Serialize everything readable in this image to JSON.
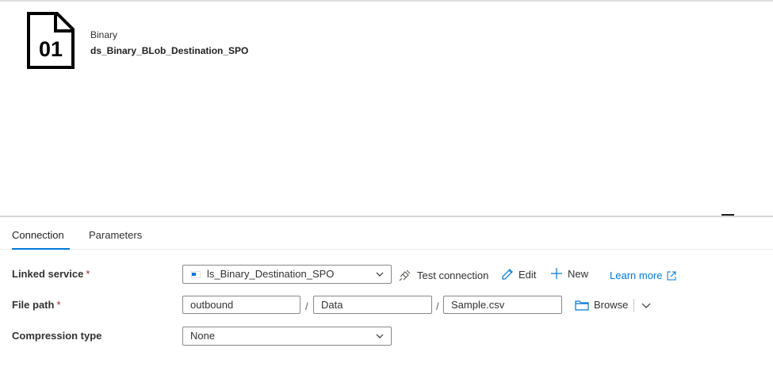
{
  "dataset": {
    "type_label": "Binary",
    "name": "ds_Binary_BLob_Destination_SPO",
    "icon": "binary-file-icon",
    "icon_text": "01"
  },
  "tabs": [
    {
      "label": "Connection",
      "active": true
    },
    {
      "label": "Parameters",
      "active": false
    }
  ],
  "linked_service": {
    "label": "Linked service",
    "required": "*",
    "value": "ls_Binary_Destination_SPO",
    "test_connection": "Test connection",
    "edit": "Edit",
    "new": "New",
    "learn_more": "Learn more"
  },
  "file_path": {
    "label": "File path",
    "required": "*",
    "container": "outbound",
    "directory": "Data",
    "file": "Sample.csv",
    "separator": "/",
    "browse": "Browse"
  },
  "compression": {
    "label": "Compression type",
    "value": "None"
  },
  "colors": {
    "accent": "#0078d4",
    "required": "#a4262c"
  }
}
